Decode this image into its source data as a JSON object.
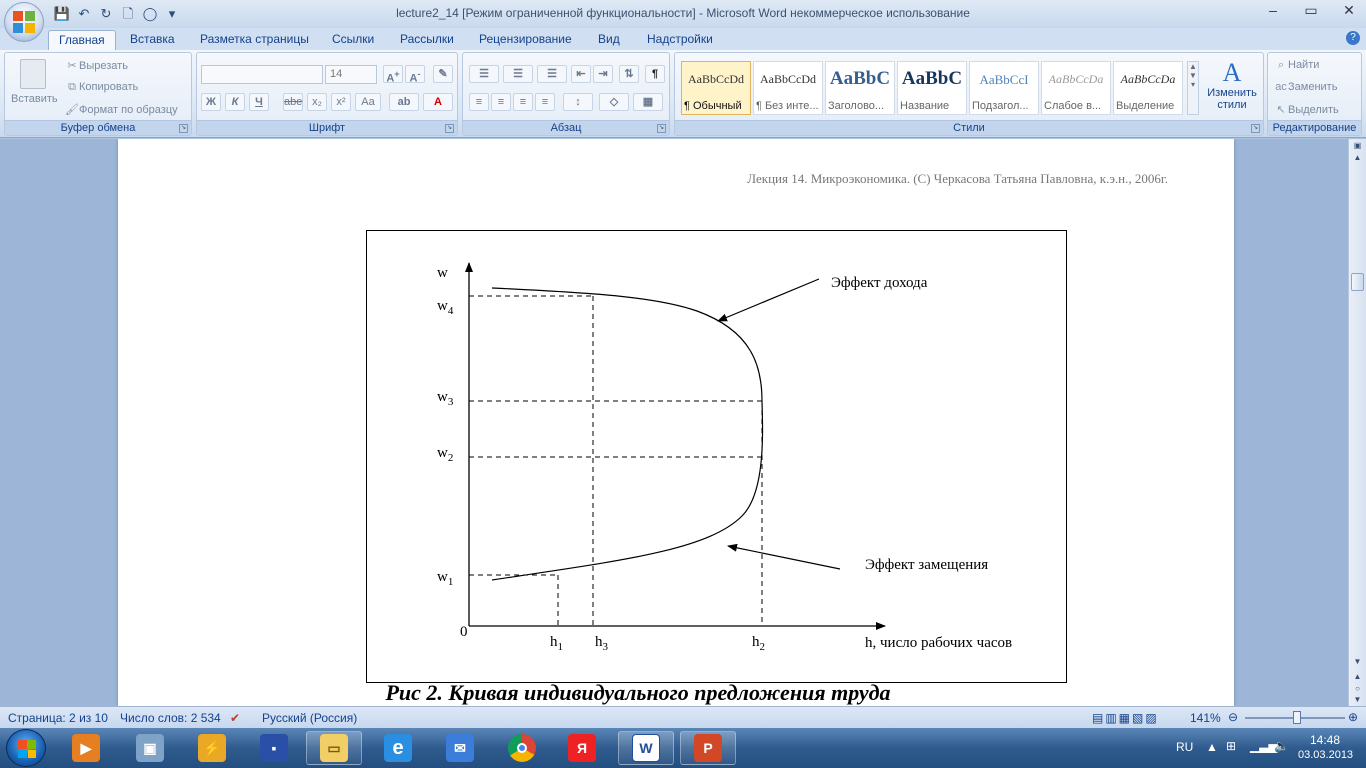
{
  "window": {
    "title": "lecture2_14 [Режим ограниченной функциональности] - Microsoft Word некоммерческое использование"
  },
  "tabs": [
    "Главная",
    "Вставка",
    "Разметка страницы",
    "Ссылки",
    "Рассылки",
    "Рецензирование",
    "Вид",
    "Надстройки"
  ],
  "ribbon": {
    "clipboard": {
      "label": "Буфер обмена",
      "paste": "Вставить",
      "cut": "Вырезать",
      "copy": "Копировать",
      "format_painter": "Формат по образцу"
    },
    "font": {
      "label": "Шрифт",
      "font_name": "",
      "font_size": "14",
      "bold": "Ж",
      "italic": "К",
      "underline": "Ч",
      "strike": "abe",
      "subscript": "x₂",
      "superscript": "x²",
      "change_case": "Aa"
    },
    "paragraph": {
      "label": "Абзац"
    },
    "styles": {
      "label": "Стили",
      "items": [
        {
          "sample": "AaBbCcDd",
          "name": "¶ Обычный"
        },
        {
          "sample": "AaBbCcDd",
          "name": "¶ Без инте..."
        },
        {
          "sample": "AaBbC",
          "name": "Заголово..."
        },
        {
          "sample": "AaBbC",
          "name": "Название"
        },
        {
          "sample": "AaBbCcI",
          "name": "Подзагол..."
        },
        {
          "sample": "AaBbCcDa",
          "name": "Слабое в..."
        },
        {
          "sample": "AaBbCcDa",
          "name": "Выделение"
        }
      ],
      "change_styles": "Изменить стили"
    },
    "editing": {
      "label": "Редактирование",
      "find": "Найти",
      "replace": "Заменить",
      "select": "Выделить"
    }
  },
  "document": {
    "header": "Лекция 14. Микроэкономика. (С) Черкасова Татьяна Павловна, к.э.н., 2006г.",
    "caption": "Рис 2. Кривая индивидуального  предложения  труда",
    "figure": {
      "y_axis_label": "w",
      "x_axis_label": "h, число рабочих часов",
      "origin_label": "0",
      "y_ticks": [
        {
          "base": "w",
          "sub": "4"
        },
        {
          "base": "w",
          "sub": "3"
        },
        {
          "base": "w",
          "sub": "2"
        },
        {
          "base": "w",
          "sub": "1"
        }
      ],
      "x_ticks": [
        {
          "base": "h",
          "sub": "1"
        },
        {
          "base": "h",
          "sub": "3"
        },
        {
          "base": "h",
          "sub": "2"
        }
      ],
      "annotation_income": "Эффект дохода",
      "annotation_substitution": "Эффект замещения"
    }
  },
  "status": {
    "page": "Страница: 2 из 10",
    "words": "Число слов: 2 534",
    "language": "Русский (Россия)",
    "zoom": "141%"
  },
  "taskbar": {
    "lang": "RU",
    "time": "14:48",
    "date": "03.03.2013"
  }
}
